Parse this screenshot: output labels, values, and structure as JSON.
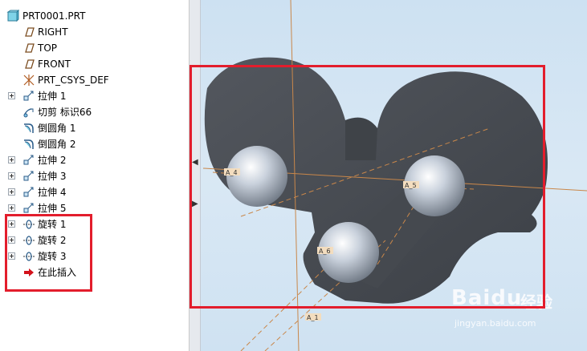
{
  "tree": {
    "root": "PRT0001.PRT",
    "items": [
      {
        "label": "RIGHT",
        "icon": "datum-plane-icon",
        "expandable": false
      },
      {
        "label": "TOP",
        "icon": "datum-plane-icon",
        "expandable": false
      },
      {
        "label": "FRONT",
        "icon": "datum-plane-icon",
        "expandable": false
      },
      {
        "label": "PRT_CSYS_DEF",
        "icon": "coordinate-system-icon",
        "expandable": false
      },
      {
        "label": "拉伸 1",
        "icon": "extrude-icon",
        "expandable": true
      },
      {
        "label": "切剪 标识66",
        "icon": "cut-icon",
        "expandable": false
      },
      {
        "label": "倒圆角 1",
        "icon": "round-icon",
        "expandable": false
      },
      {
        "label": "倒圆角 2",
        "icon": "round-icon",
        "expandable": false
      },
      {
        "label": "拉伸 2",
        "icon": "extrude-icon",
        "expandable": true
      },
      {
        "label": "拉伸 3",
        "icon": "extrude-icon",
        "expandable": true
      },
      {
        "label": "拉伸 4",
        "icon": "extrude-icon",
        "expandable": true
      },
      {
        "label": "拉伸 5",
        "icon": "extrude-icon",
        "expandable": true
      },
      {
        "label": "旋转 1",
        "icon": "revolve-icon",
        "expandable": true
      },
      {
        "label": "旋转 2",
        "icon": "revolve-icon",
        "expandable": true
      },
      {
        "label": "旋转 3",
        "icon": "revolve-icon",
        "expandable": true
      },
      {
        "label": "在此插入",
        "icon": "insert-here-arrow-icon",
        "expandable": false
      }
    ]
  },
  "viewport": {
    "axis_labels": [
      "A_4",
      "A_5",
      "A_6",
      "A_1"
    ]
  },
  "colors": {
    "highlight_red": "#e31d2c",
    "model_dark": "#4a4e54",
    "datum_orange": "#c9874a",
    "viewport_bg": "#d5e6f3"
  },
  "watermark": {
    "brand": "Baidu",
    "cn": "经验",
    "url": "jingyan.baidu.com"
  }
}
